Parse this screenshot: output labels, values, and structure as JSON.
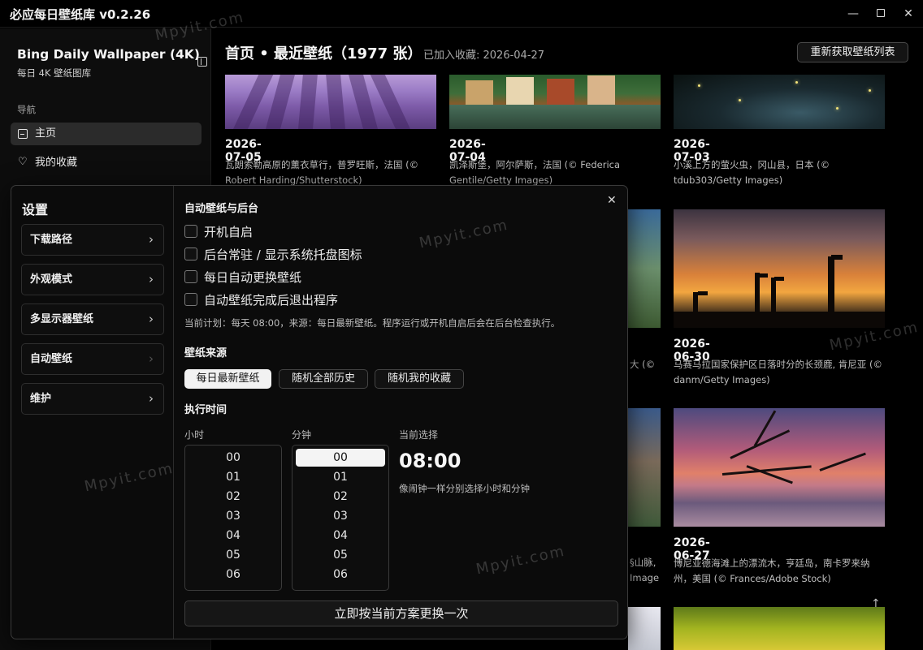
{
  "window": {
    "title": "必应每日壁纸库 v0.2.26",
    "minimize": "—",
    "close": "✕"
  },
  "sidebar": {
    "brand_title": "Bing Daily Wallpaper (4K)",
    "brand_subtitle": "每日 4K 壁纸图库",
    "nav_label": "导航",
    "items": [
      {
        "label": "主页",
        "icon": "home-icon",
        "active": true
      },
      {
        "label": "我的收藏",
        "icon": "heart-icon",
        "active": false
      }
    ]
  },
  "main": {
    "title": "首页 • 最近壁纸（1977 张）",
    "subtitle": "已加入收藏: 2026-04-27",
    "refresh_label": "重新获取壁纸列表",
    "cards": [
      {
        "date": "2026-07-05",
        "desc": "瓦朗索勒高原的薰衣草行，普罗旺斯，法国 (© Robert Harding/Shutterstock)"
      },
      {
        "date": "2026-07-04",
        "desc": "凯泽斯堡，阿尔萨斯，法国 (© Federica Gentile/Getty Images)"
      },
      {
        "date": "2026-07-03",
        "desc": "小溪上方的萤火虫，冈山县，日本 (© tdub303/Getty Images)"
      },
      {
        "date": "2026-06-30",
        "desc": "马赛马拉国家保护区日落时分的长颈鹿, 肯尼亚 (© danm/Getty Images)"
      },
      {
        "date": "2026-06-27",
        "desc": "博尼亚德海滩上的漂流木，亨廷岛，南卡罗来纳州，美国 (© Frances/Adobe Stock)"
      }
    ],
    "partial_texts": [
      "大 (©",
      "§山脉,",
      "Image"
    ],
    "scroll_up": "↑"
  },
  "settings": {
    "title": "设置",
    "menu": [
      {
        "label": "下载路径",
        "chevron": "›"
      },
      {
        "label": "外观模式",
        "chevron": "›"
      },
      {
        "label": "多显示器壁纸",
        "chevron": "›"
      },
      {
        "label": "自动壁纸",
        "chevron": "›"
      },
      {
        "label": "维护",
        "chevron": "›"
      }
    ],
    "close": "✕",
    "section_auto": "自动壁纸与后台",
    "checkboxes": [
      {
        "label": "开机自启",
        "checked": false
      },
      {
        "label": "后台常驻 / 显示系统托盘图标",
        "checked": false
      },
      {
        "label": "每日自动更换壁纸",
        "checked": false
      },
      {
        "label": "自动壁纸完成后退出程序",
        "checked": false
      }
    ],
    "plan_text": "当前计划：每天 08:00，来源：每日最新壁纸。程序运行或开机自启后会在后台检查执行。",
    "section_source": "壁纸来源",
    "sources": [
      {
        "label": "每日最新壁纸",
        "active": true
      },
      {
        "label": "随机全部历史",
        "active": false
      },
      {
        "label": "随机我的收藏",
        "active": false
      }
    ],
    "section_time": "执行时间",
    "hour_label": "小时",
    "minute_label": "分钟",
    "hours": [
      "00",
      "01",
      "02",
      "03",
      "04",
      "05",
      "06"
    ],
    "minutes": [
      "00",
      "01",
      "02",
      "03",
      "04",
      "05",
      "06"
    ],
    "selected_hour": "00",
    "selected_minute": "00",
    "current_label": "当前选择",
    "current_time": "08:00",
    "current_hint": "像闹钟一样分别选择小时和分钟",
    "apply_label": "立即按当前方案更换一次"
  },
  "watermark": "Mpyit.com",
  "colors": {
    "background": "#000000",
    "panel": "#0b0b0b",
    "active_nav": "#2b2b2b",
    "selected": "#f2f2f2"
  }
}
